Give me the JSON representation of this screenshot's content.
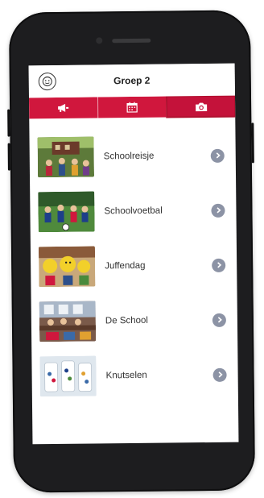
{
  "header": {
    "title": "Groep 2",
    "logo_icon": "child-face-logo"
  },
  "tabs": [
    {
      "icon": "megaphone-icon",
      "active": false
    },
    {
      "icon": "calendar-icon",
      "active": false
    },
    {
      "icon": "camera-icon",
      "active": true
    }
  ],
  "albums": [
    {
      "label": "Schoolreisje"
    },
    {
      "label": "Schoolvoetbal"
    },
    {
      "label": "Juffendag"
    },
    {
      "label": "De School"
    },
    {
      "label": "Knutselen"
    }
  ],
  "colors": {
    "accent": "#d0173d",
    "chevron": "#8c93a5",
    "device": "#1d1d1f"
  }
}
